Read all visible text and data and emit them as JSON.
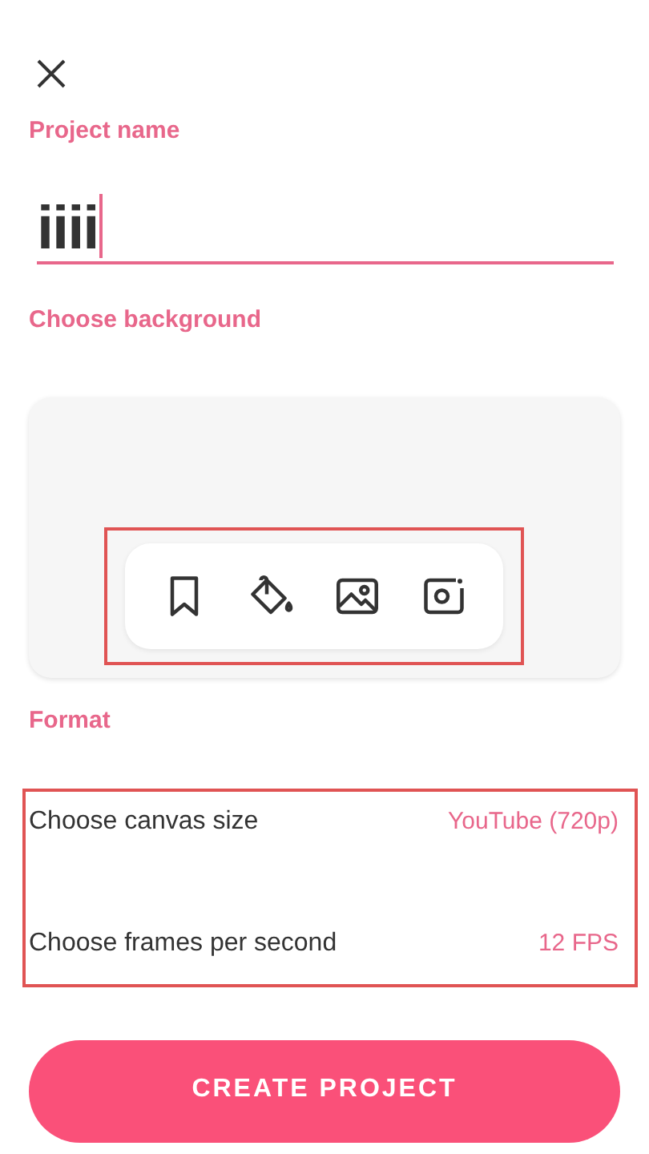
{
  "project_name": {
    "label": "Project name",
    "value": "iiii"
  },
  "background": {
    "label": "Choose background",
    "highlighted": true,
    "tools": [
      {
        "kind": "bookmark"
      },
      {
        "kind": "paint"
      },
      {
        "kind": "image"
      },
      {
        "kind": "camera"
      }
    ]
  },
  "format": {
    "label": "Format",
    "highlighted": true,
    "rows": [
      {
        "label": "Choose canvas size",
        "value": "YouTube (720p)"
      },
      {
        "label": "Choose frames per second",
        "value": "12 FPS"
      }
    ]
  },
  "create_button": "CREATE PROJECT"
}
